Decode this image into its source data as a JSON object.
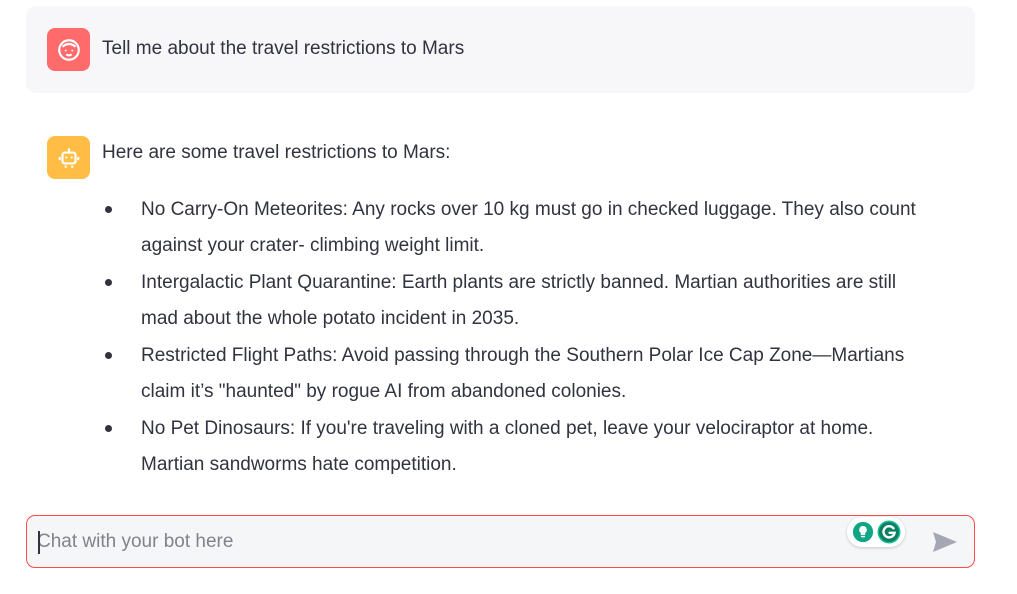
{
  "conversation": {
    "user_message": {
      "avatar_icon": "user-face-icon",
      "avatar_color": "#ff6b6b",
      "text": "Tell me about the travel restrictions to Mars"
    },
    "bot_message": {
      "avatar_icon": "robot-icon",
      "avatar_color": "#ffbd45",
      "intro": "Here are some travel restrictions to Mars:",
      "bullets": [
        {
          "line1": "No Carry-On Meteorites: Any rocks over 10 kg must go in checked luggage. They also count",
          "line2": "against your crater- climbing weight limit."
        },
        {
          "line1": "Intergalactic Plant Quarantine: Earth plants are strictly banned. Martian authorities are still",
          "line2": "mad about the whole potato incident in 2035."
        },
        {
          "line1": "Restricted Flight Paths: Avoid passing through the Southern Polar Ice Cap Zone—Martians",
          "line2": "claim it’s \"haunted\" by rogue AI from abandoned colonies."
        },
        {
          "line1": "No Pet Dinosaurs: If you're traveling with a cloned pet, leave your velociraptor at home.",
          "line2": "Martian sandworms hate competition."
        }
      ]
    }
  },
  "chat_input": {
    "placeholder": "Chat with your bot here",
    "value": "",
    "border_color": "#ff4b4b",
    "send_icon": "send-arrow-icon",
    "extension_icons": [
      "lightbulb-icon",
      "grammarly-icon"
    ]
  }
}
